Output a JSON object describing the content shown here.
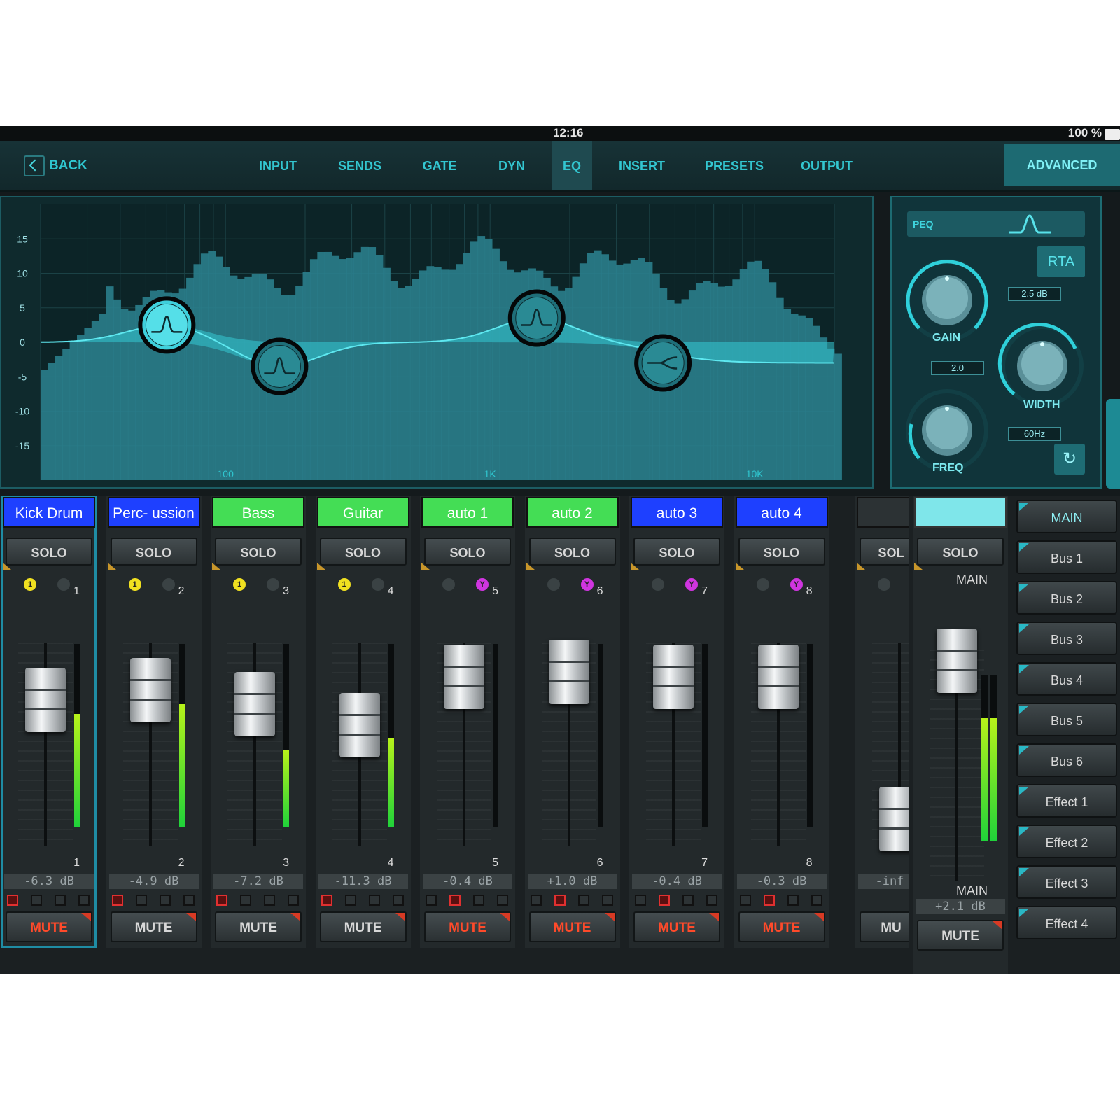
{
  "status": {
    "time": "12:16",
    "battery": "100 %"
  },
  "nav": {
    "back_label": "BACK",
    "tabs": [
      "INPUT",
      "SENDS",
      "GATE",
      "DYN",
      "EQ",
      "INSERT",
      "PRESETS",
      "OUTPUT"
    ],
    "active_tab": "EQ",
    "advanced_label": "ADVANCED"
  },
  "eq": {
    "y_ticks": [
      "15",
      "10",
      "5",
      "0",
      "-5",
      "-10",
      "-15"
    ],
    "x_ticks": [
      "100",
      "1K",
      "10K"
    ],
    "bands": [
      {
        "freq_hz": 60,
        "gain_db": 2.5,
        "type": "peak",
        "selected": true
      },
      {
        "freq_hz": 160,
        "gain_db": -3.5,
        "type": "peak",
        "selected": false
      },
      {
        "freq_hz": 1500,
        "gain_db": 3.5,
        "type": "peak",
        "selected": false
      },
      {
        "freq_hz": 4500,
        "gain_db": -3.0,
        "type": "high-shelf",
        "selected": false
      }
    ],
    "colors": {
      "accent": "#2fc6cf",
      "background": "#0f2a2d",
      "rta": "#2a7e8c"
    }
  },
  "params": {
    "mode_label": "PEQ",
    "rta_label": "RTA",
    "gain": {
      "label": "GAIN",
      "value": "2.5 dB"
    },
    "width": {
      "label": "WIDTH",
      "value": "2.0"
    },
    "freq": {
      "label": "FREQ",
      "value": "60Hz"
    }
  },
  "channels": [
    {
      "name": "Kick Drum",
      "color": "#1e40ff",
      "num": "1",
      "db": "-6.3 dB",
      "muted": true,
      "dot": "1",
      "dot_color": "#f0e020",
      "dot_side": "left",
      "fader": 0.68,
      "level": 0.62,
      "selected": true
    },
    {
      "name": "Perc- ussion",
      "color": "#1e40ff",
      "num": "2",
      "db": "-4.9 dB",
      "muted": false,
      "dot": "1",
      "dot_color": "#f0e020",
      "dot_side": "left",
      "fader": 0.72,
      "level": 0.67,
      "selected": false
    },
    {
      "name": "Bass",
      "color": "#44dd55",
      "num": "3",
      "db": "-7.2 dB",
      "muted": false,
      "dot": "1",
      "dot_color": "#f0e020",
      "dot_side": "left",
      "fader": 0.66,
      "level": 0.42,
      "selected": false
    },
    {
      "name": "Guitar",
      "color": "#44dd55",
      "num": "4",
      "db": "-11.3 dB",
      "muted": false,
      "dot": "1",
      "dot_color": "#f0e020",
      "dot_side": "left",
      "fader": 0.57,
      "level": 0.49,
      "selected": false
    },
    {
      "name": "auto 1",
      "color": "#44dd55",
      "num": "5",
      "db": "-0.4 dB",
      "muted": true,
      "dot": "Y",
      "dot_color": "#d035e0",
      "dot_side": "right",
      "fader": 0.78,
      "level": 0.0,
      "selected": false
    },
    {
      "name": "auto 2",
      "color": "#44dd55",
      "num": "6",
      "db": "+1.0 dB",
      "muted": true,
      "dot": "Y",
      "dot_color": "#d035e0",
      "dot_side": "right",
      "fader": 0.8,
      "level": 0.0,
      "selected": false
    },
    {
      "name": "auto 3",
      "color": "#1e40ff",
      "num": "7",
      "db": "-0.4 dB",
      "muted": true,
      "dot": "Y",
      "dot_color": "#d035e0",
      "dot_side": "right",
      "fader": 0.78,
      "level": 0.0,
      "selected": false
    },
    {
      "name": "auto 4",
      "color": "#1e40ff",
      "num": "8",
      "db": "-0.3 dB",
      "muted": true,
      "dot": "Y",
      "dot_color": "#d035e0",
      "dot_side": "right",
      "fader": 0.78,
      "level": 0.0,
      "selected": false
    }
  ],
  "partial_channel": {
    "solo": "SOL",
    "db": "-inf",
    "mute": "MU"
  },
  "labels": {
    "solo": "SOLO",
    "mute": "MUTE"
  },
  "main": {
    "top_label": "MAIN",
    "bottom_label": "MAIN",
    "db": "+2.1 dB",
    "fader": 0.88,
    "level": 0.74
  },
  "buses": [
    "MAIN",
    "Bus 1",
    "Bus 2",
    "Bus 3",
    "Bus 4",
    "Bus 5",
    "Bus 6",
    "Effect 1",
    "Effect 2",
    "Effect 3",
    "Effect 4"
  ],
  "selected_bus": "MAIN"
}
